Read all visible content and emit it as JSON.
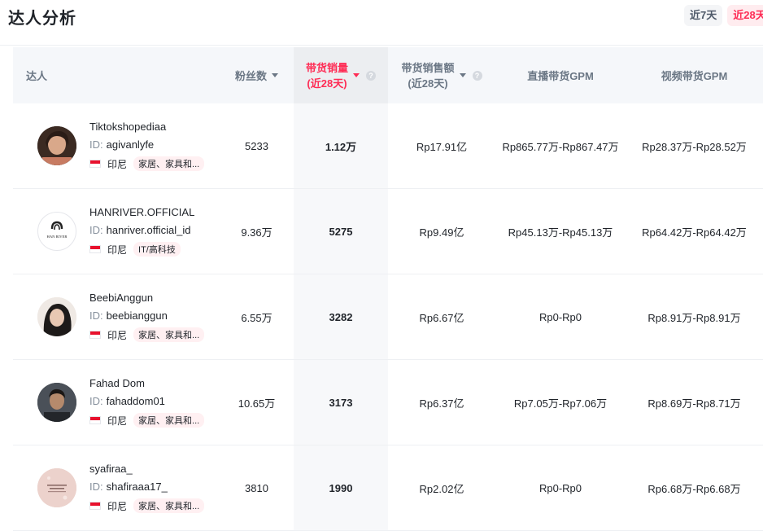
{
  "page": {
    "title": "达人分析"
  },
  "range": {
    "options": [
      "近7天",
      "近28天"
    ]
  },
  "colors": {
    "accent": "#fe2c55",
    "tag_bg": "#fff0f2",
    "header_bg": "#f5f7fa"
  },
  "table": {
    "headers": {
      "talent": "达人",
      "fans": "粉丝数",
      "sales_line1": "带货销量",
      "sales_line2": "(近28天)",
      "amount_line1": "带货销售额",
      "amount_line2": "(近28天)",
      "live_gpm": "直播带货GPM",
      "video_gpm": "视频带货GPM"
    },
    "rows": [
      {
        "name": "Tiktokshopediaa",
        "id_label": "ID:",
        "id": "agivanlyfe",
        "country": "印尼",
        "category": "家居、家具和...",
        "fans": "5233",
        "sales": "1.12万",
        "amount": "Rp17.91亿",
        "live_gpm": "Rp865.77万-Rp867.47万",
        "video_gpm": "Rp28.37万-Rp28.52万",
        "avatar_icon": "person-photo-icon"
      },
      {
        "name": "HANRIVER.OFFICIAL",
        "id_label": "ID:",
        "id": "hanriver.official_id",
        "country": "印尼",
        "category": "IT/高科技",
        "fans": "9.36万",
        "sales": "5275",
        "amount": "Rp9.49亿",
        "live_gpm": "Rp45.13万-Rp45.13万",
        "video_gpm": "Rp64.42万-Rp64.42万",
        "avatar_icon": "han-river-logo",
        "logo_text": "HAN RIVER"
      },
      {
        "name": "BeebiAnggun",
        "id_label": "ID:",
        "id": "beebianggun",
        "country": "印尼",
        "category": "家居、家具和...",
        "fans": "6.55万",
        "sales": "3282",
        "amount": "Rp6.67亿",
        "live_gpm": "Rp0-Rp0",
        "video_gpm": "Rp8.91万-Rp8.91万",
        "avatar_icon": "person-photo-icon"
      },
      {
        "name": "Fahad Dom",
        "id_label": "ID:",
        "id": "fahaddom01",
        "country": "印尼",
        "category": "家居、家具和...",
        "fans": "10.65万",
        "sales": "3173",
        "amount": "Rp6.37亿",
        "live_gpm": "Rp7.05万-Rp7.06万",
        "video_gpm": "Rp8.69万-Rp8.71万",
        "avatar_icon": "person-photo-icon"
      },
      {
        "name": "syafiraa_",
        "id_label": "ID:",
        "id": "shafiraaa17_",
        "country": "印尼",
        "category": "家居、家具和...",
        "fans": "3810",
        "sales": "1990",
        "amount": "Rp2.02亿",
        "live_gpm": "Rp0-Rp0",
        "video_gpm": "Rp6.68万-Rp6.68万",
        "avatar_icon": "pink-graphic-icon"
      }
    ]
  }
}
